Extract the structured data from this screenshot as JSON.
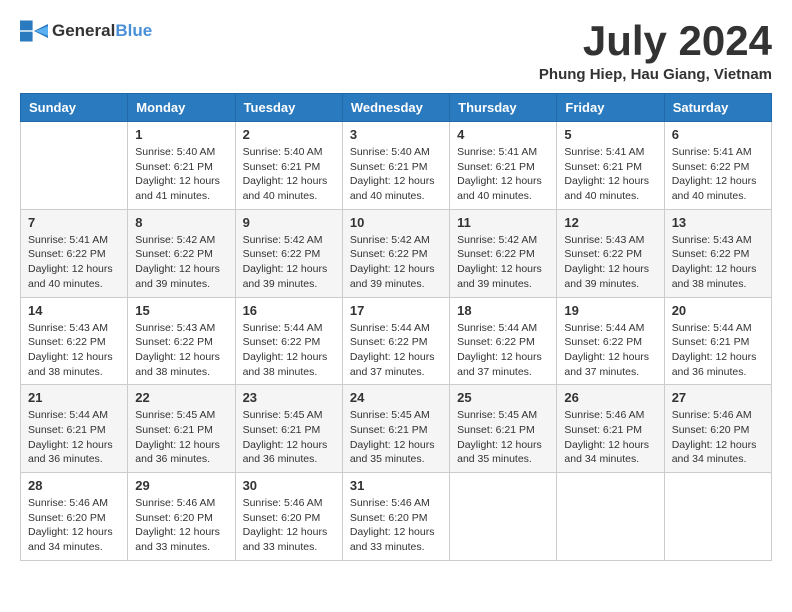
{
  "header": {
    "logo_general": "General",
    "logo_blue": "Blue",
    "title": "July 2024",
    "location": "Phung Hiep, Hau Giang, Vietnam"
  },
  "days_of_week": [
    "Sunday",
    "Monday",
    "Tuesday",
    "Wednesday",
    "Thursday",
    "Friday",
    "Saturday"
  ],
  "weeks": [
    [
      {
        "day": "",
        "info": ""
      },
      {
        "day": "1",
        "info": "Sunrise: 5:40 AM\nSunset: 6:21 PM\nDaylight: 12 hours\nand 41 minutes."
      },
      {
        "day": "2",
        "info": "Sunrise: 5:40 AM\nSunset: 6:21 PM\nDaylight: 12 hours\nand 40 minutes."
      },
      {
        "day": "3",
        "info": "Sunrise: 5:40 AM\nSunset: 6:21 PM\nDaylight: 12 hours\nand 40 minutes."
      },
      {
        "day": "4",
        "info": "Sunrise: 5:41 AM\nSunset: 6:21 PM\nDaylight: 12 hours\nand 40 minutes."
      },
      {
        "day": "5",
        "info": "Sunrise: 5:41 AM\nSunset: 6:21 PM\nDaylight: 12 hours\nand 40 minutes."
      },
      {
        "day": "6",
        "info": "Sunrise: 5:41 AM\nSunset: 6:22 PM\nDaylight: 12 hours\nand 40 minutes."
      }
    ],
    [
      {
        "day": "7",
        "info": ""
      },
      {
        "day": "8",
        "info": "Sunrise: 5:42 AM\nSunset: 6:22 PM\nDaylight: 12 hours\nand 39 minutes."
      },
      {
        "day": "9",
        "info": "Sunrise: 5:42 AM\nSunset: 6:22 PM\nDaylight: 12 hours\nand 39 minutes."
      },
      {
        "day": "10",
        "info": "Sunrise: 5:42 AM\nSunset: 6:22 PM\nDaylight: 12 hours\nand 39 minutes."
      },
      {
        "day": "11",
        "info": "Sunrise: 5:42 AM\nSunset: 6:22 PM\nDaylight: 12 hours\nand 39 minutes."
      },
      {
        "day": "12",
        "info": "Sunrise: 5:43 AM\nSunset: 6:22 PM\nDaylight: 12 hours\nand 39 minutes."
      },
      {
        "day": "13",
        "info": "Sunrise: 5:43 AM\nSunset: 6:22 PM\nDaylight: 12 hours\nand 38 minutes."
      }
    ],
    [
      {
        "day": "14",
        "info": ""
      },
      {
        "day": "15",
        "info": "Sunrise: 5:43 AM\nSunset: 6:22 PM\nDaylight: 12 hours\nand 38 minutes."
      },
      {
        "day": "16",
        "info": "Sunrise: 5:44 AM\nSunset: 6:22 PM\nDaylight: 12 hours\nand 38 minutes."
      },
      {
        "day": "17",
        "info": "Sunrise: 5:44 AM\nSunset: 6:22 PM\nDaylight: 12 hours\nand 37 minutes."
      },
      {
        "day": "18",
        "info": "Sunrise: 5:44 AM\nSunset: 6:22 PM\nDaylight: 12 hours\nand 37 minutes."
      },
      {
        "day": "19",
        "info": "Sunrise: 5:44 AM\nSunset: 6:22 PM\nDaylight: 12 hours\nand 37 minutes."
      },
      {
        "day": "20",
        "info": "Sunrise: 5:44 AM\nSunset: 6:21 PM\nDaylight: 12 hours\nand 36 minutes."
      }
    ],
    [
      {
        "day": "21",
        "info": ""
      },
      {
        "day": "22",
        "info": "Sunrise: 5:45 AM\nSunset: 6:21 PM\nDaylight: 12 hours\nand 36 minutes."
      },
      {
        "day": "23",
        "info": "Sunrise: 5:45 AM\nSunset: 6:21 PM\nDaylight: 12 hours\nand 36 minutes."
      },
      {
        "day": "24",
        "info": "Sunrise: 5:45 AM\nSunset: 6:21 PM\nDaylight: 12 hours\nand 35 minutes."
      },
      {
        "day": "25",
        "info": "Sunrise: 5:45 AM\nSunset: 6:21 PM\nDaylight: 12 hours\nand 35 minutes."
      },
      {
        "day": "26",
        "info": "Sunrise: 5:46 AM\nSunset: 6:21 PM\nDaylight: 12 hours\nand 34 minutes."
      },
      {
        "day": "27",
        "info": "Sunrise: 5:46 AM\nSunset: 6:20 PM\nDaylight: 12 hours\nand 34 minutes."
      }
    ],
    [
      {
        "day": "28",
        "info": "Sunrise: 5:46 AM\nSunset: 6:20 PM\nDaylight: 12 hours\nand 34 minutes."
      },
      {
        "day": "29",
        "info": "Sunrise: 5:46 AM\nSunset: 6:20 PM\nDaylight: 12 hours\nand 33 minutes."
      },
      {
        "day": "30",
        "info": "Sunrise: 5:46 AM\nSunset: 6:20 PM\nDaylight: 12 hours\nand 33 minutes."
      },
      {
        "day": "31",
        "info": "Sunrise: 5:46 AM\nSunset: 6:20 PM\nDaylight: 12 hours\nand 33 minutes."
      },
      {
        "day": "",
        "info": ""
      },
      {
        "day": "",
        "info": ""
      },
      {
        "day": "",
        "info": ""
      }
    ]
  ],
  "week7_sunday_info": "Sunrise: 5:41 AM\nSunset: 6:22 PM\nDaylight: 12 hours\nand 40 minutes.",
  "week14_sunday_info": "Sunrise: 5:43 AM\nSunset: 6:22 PM\nDaylight: 12 hours\nand 38 minutes.",
  "week21_sunday_info": "Sunrise: 5:44 AM\nSunset: 6:21 PM\nDaylight: 12 hours\nand 36 minutes."
}
